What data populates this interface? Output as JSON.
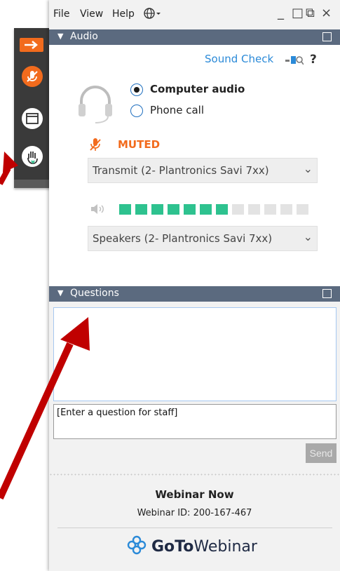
{
  "menu": {
    "file": "File",
    "view": "View",
    "help": "Help"
  },
  "window_controls": {
    "minimize": "_",
    "maximize": "□",
    "restore": "⧉",
    "close": "×"
  },
  "audio": {
    "section_title": "Audio",
    "sound_check": "Sound Check",
    "help_mark": "?",
    "option_computer": "Computer audio",
    "option_phone": "Phone call",
    "selected_option": "computer",
    "muted_label": "MUTED",
    "transmit_device": "Transmit (2- Plantronics Savi 7xx)",
    "speaker_device": "Speakers (2- Plantronics Savi 7xx)",
    "speaker_level_fraction": 0.5833,
    "level_segments_total": 12,
    "colors": {
      "accent": "#2b8ad8",
      "muted": "#f26b1d",
      "level_on": "#2ec28f"
    }
  },
  "questions": {
    "section_title": "Questions",
    "input_placeholder": "[Enter a question for staff]",
    "send_label": "Send"
  },
  "footer": {
    "title": "Webinar Now",
    "webinar_id_text": "Webinar ID: 200-167-467",
    "brand_bold": "GoTo",
    "brand_regular": "Webinar"
  },
  "side_tools": [
    "arrow-right-icon",
    "mic-muted-icon",
    "screen-icon",
    "raise-hand-icon"
  ],
  "colors": {
    "panel": "#f2f2f2",
    "section_header": "#5b6a7f",
    "arrows": "#c00000"
  }
}
